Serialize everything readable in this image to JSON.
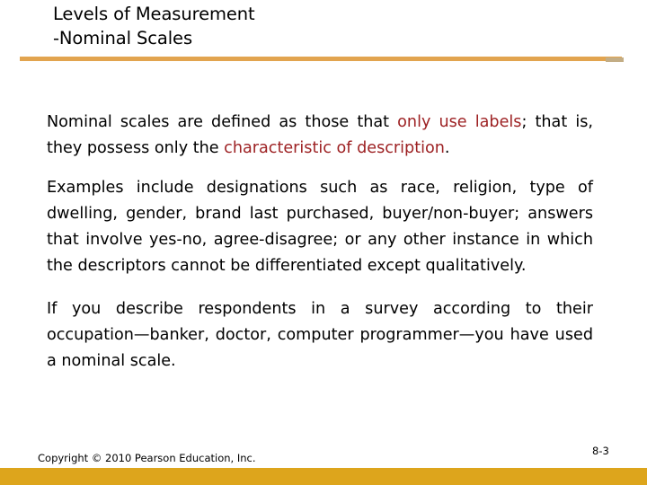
{
  "slide": {
    "title": {
      "line1": "Levels of Measurement",
      "line2": "-Nominal Scales"
    },
    "body": {
      "paragraph1": {
        "seg1": "Nominal scales are defined as those that ",
        "highlight1": "only use labels",
        "seg2": "; that is, they possess only the ",
        "highlight2": "characteristic of description",
        "seg3": "."
      },
      "paragraph2": "Examples include designations such as race, religion, type of dwelling, gender, brand last purchased, buyer/non-buyer; answers that involve yes-no, agree-disagree; or any other instance in which the descriptors cannot be differentiated except qualitatively.",
      "paragraph3": "If you describe respondents in a survey according to their occupation—banker, doctor, computer programmer—you have used a nominal scale."
    },
    "footer": {
      "copyright": "Copyright © 2010 Pearson Education, Inc.",
      "page_number": "8-3"
    },
    "colors": {
      "highlight_text": "#9d2123",
      "title_rule": "#e2a44f",
      "title_rule_tail": "#c3ad85",
      "footer_bar": "#dda51c",
      "body_text": "#000000",
      "background": "#ffffff"
    }
  }
}
